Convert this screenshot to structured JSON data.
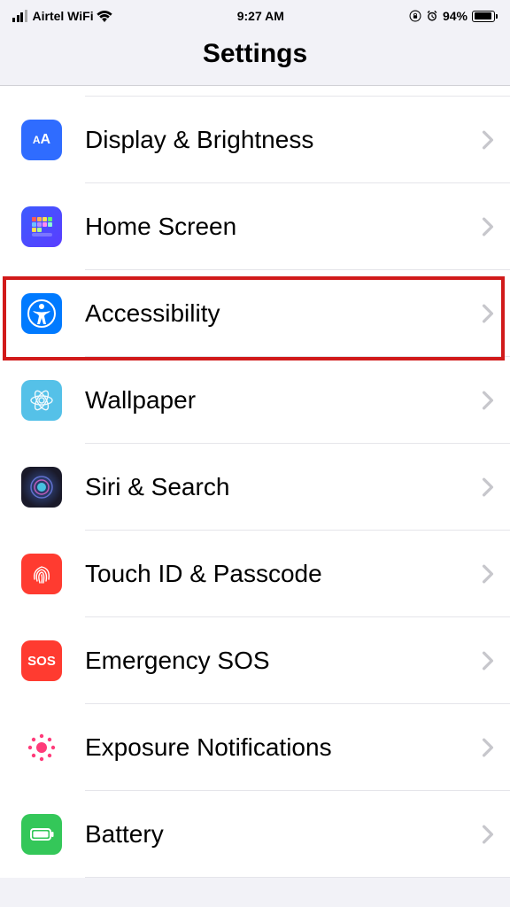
{
  "status_bar": {
    "carrier": "Airtel WiFi",
    "time": "9:27 AM",
    "battery_pct": "94%"
  },
  "header": {
    "title": "Settings"
  },
  "rows": [
    {
      "label": "Display & Brightness"
    },
    {
      "label": "Home Screen"
    },
    {
      "label": "Accessibility"
    },
    {
      "label": "Wallpaper"
    },
    {
      "label": "Siri & Search"
    },
    {
      "label": "Touch ID & Passcode"
    },
    {
      "label": "Emergency SOS"
    },
    {
      "label": "Exposure Notifications"
    },
    {
      "label": "Battery"
    }
  ],
  "highlighted_row_label": "Accessibility"
}
